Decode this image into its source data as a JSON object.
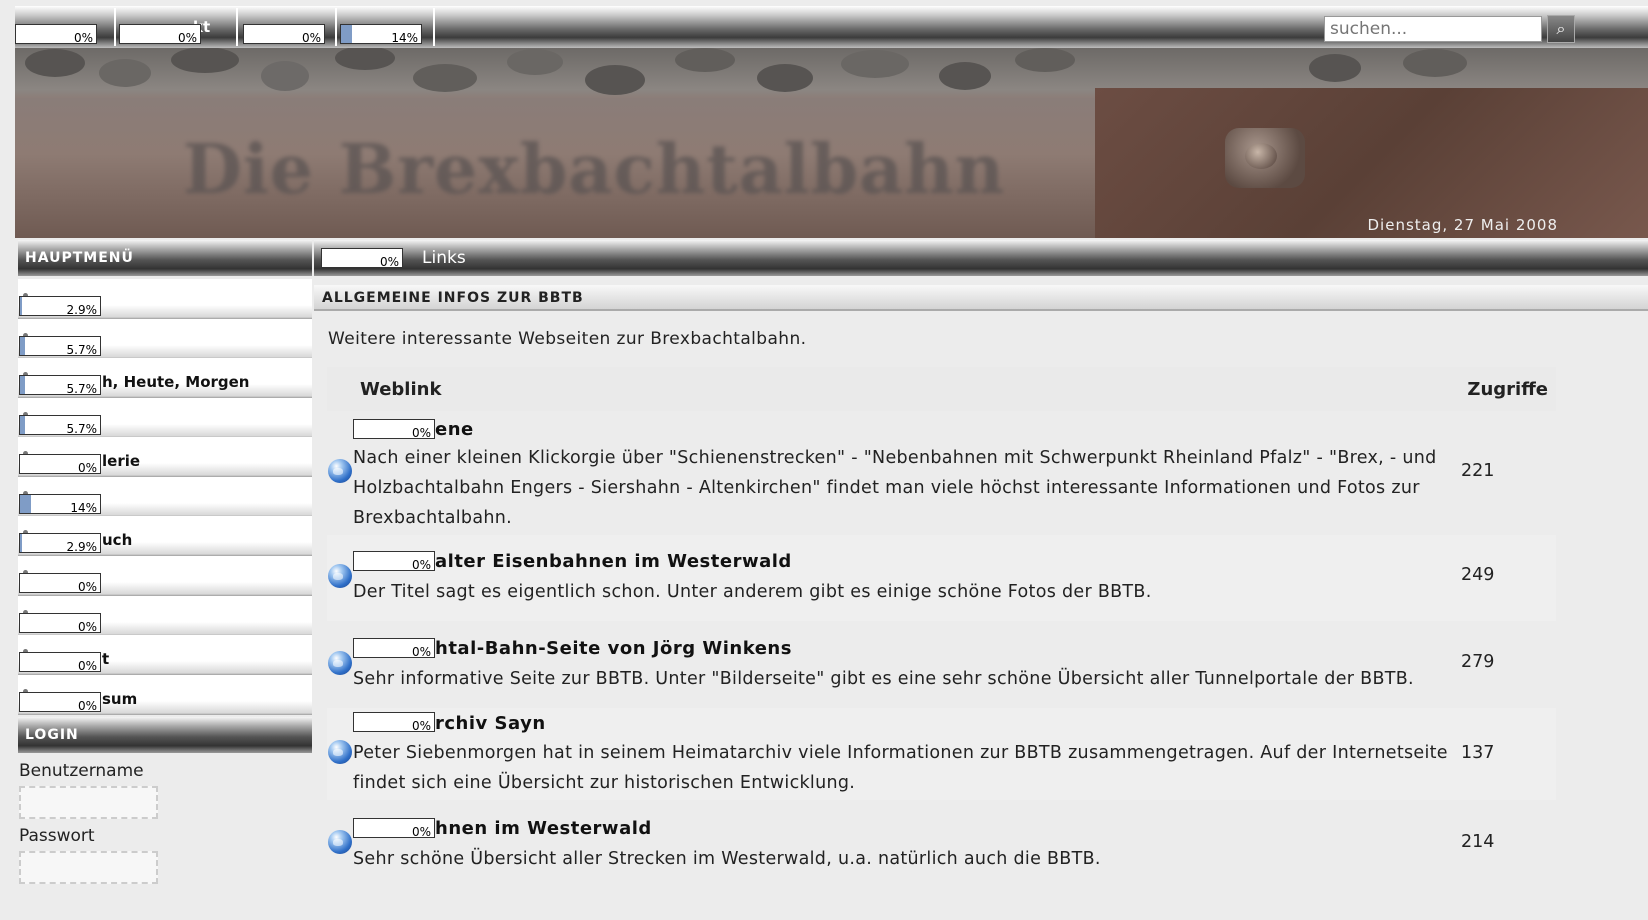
{
  "topnav": {
    "tabs": [
      {
        "label": "",
        "progress": "0%",
        "fill": 0
      },
      {
        "label": "kt",
        "progress": "0%",
        "fill": 0
      },
      {
        "label": "",
        "progress": "0%",
        "fill": 0
      },
      {
        "label": "",
        "progress": "14%",
        "fill": 0.14
      }
    ],
    "search_placeholder": "suchen...",
    "search_icon": "magnifier-icon"
  },
  "header": {
    "title": "Die Brexbachtalbahn",
    "date": "Dienstag, 27 Mai 2008"
  },
  "sidebar": {
    "main_menu_title": "HAUPTMENÜ",
    "items": [
      {
        "text": "",
        "progress": "2.9%",
        "fill": 0.029
      },
      {
        "text": "",
        "progress": "5.7%",
        "fill": 0.057
      },
      {
        "text": "h, Heute, Morgen",
        "progress": "5.7%",
        "fill": 0.057
      },
      {
        "text": "",
        "progress": "5.7%",
        "fill": 0.057
      },
      {
        "text": "lerie",
        "progress": "0%",
        "fill": 0
      },
      {
        "text": "",
        "progress": "14%",
        "fill": 0.14
      },
      {
        "text": "uch",
        "progress": "2.9%",
        "fill": 0.029
      },
      {
        "text": "",
        "progress": "0%",
        "fill": 0
      },
      {
        "text": "",
        "progress": "0%",
        "fill": 0
      },
      {
        "text": "t",
        "progress": "0%",
        "fill": 0
      },
      {
        "text": "sum",
        "progress": "0%",
        "fill": 0
      }
    ],
    "login_title": "LOGIN",
    "username_label": "Benutzername",
    "password_label": "Passwort"
  },
  "content": {
    "head_progress": "0%",
    "head_fill": 0,
    "head_label": "Links",
    "section_title": "ALLGEMEINE INFOS ZUR BBTB",
    "intro": "Weitere interessante Webseiten zur Brexbachtalbahn.",
    "col_weblink": "Weblink",
    "col_hits": "Zugriffe",
    "links": [
      {
        "progress": "0%",
        "title": "ene",
        "desc": "Nach einer kleinen Klickorgie über \"Schienenstrecken\" - \"Nebenbahnen mit Schwerpunkt Rheinland Pfalz\" - \"Brex, - und Holzbachtalbahn Engers - Siershahn - Altenkirchen\" findet man viele höchst interessante Informationen und Fotos zur Brexbachtalbahn.",
        "hits": "221"
      },
      {
        "progress": "0%",
        "title": "alter Eisenbahnen im Westerwald",
        "desc": "Der Titel sagt es eigentlich schon. Unter anderem gibt es einige schöne Fotos der BBTB.",
        "hits": "249"
      },
      {
        "progress": "0%",
        "title": "htal-Bahn-Seite von Jörg Winkens",
        "desc": "Sehr informative Seite zur BBTB. Unter \"Bilderseite\" gibt es eine sehr schöne Übersicht aller Tunnelportale der BBTB.",
        "hits": "279"
      },
      {
        "progress": "0%",
        "title": "rchiv Sayn",
        "desc": "Peter Siebenmorgen hat in seinem Heimatarchiv viele Informationen zur BBTB zusammengetragen. Auf der Internetseite findet sich eine Übersicht zur historischen Entwicklung.",
        "hits": "137"
      },
      {
        "progress": "0%",
        "title": "hnen im Westerwald",
        "desc": "Sehr schöne Übersicht aller Strecken im Westerwald, u.a. natürlich auch die BBTB.",
        "hits": "214"
      }
    ]
  }
}
